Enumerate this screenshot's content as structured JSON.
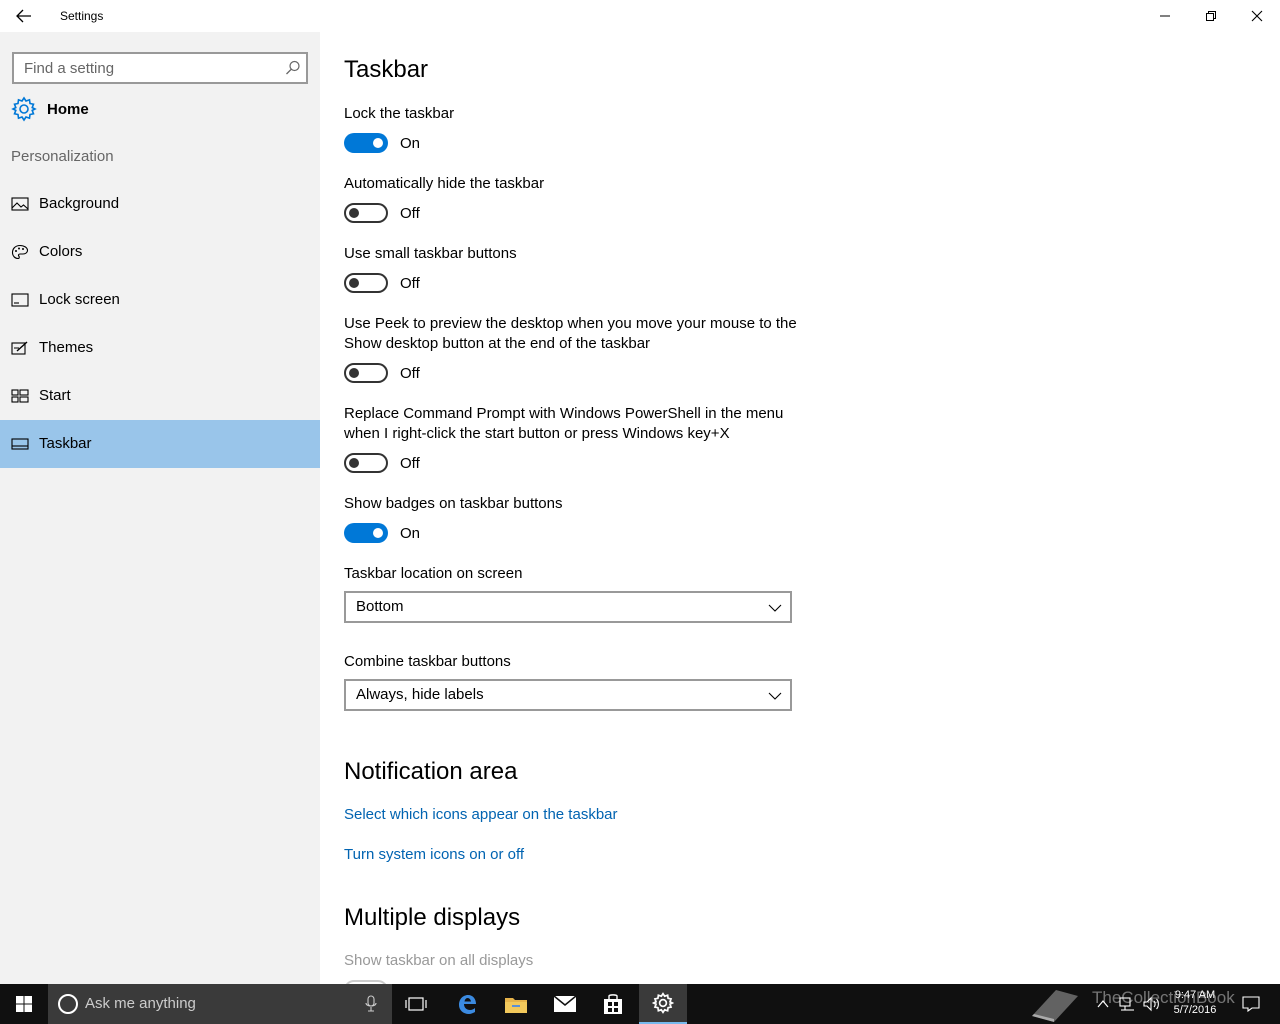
{
  "window": {
    "title": "Settings"
  },
  "sidebar": {
    "search_placeholder": "Find a setting",
    "home_label": "Home",
    "section_label": "Personalization",
    "items": [
      {
        "label": "Background",
        "icon": "picture-icon"
      },
      {
        "label": "Colors",
        "icon": "palette-icon"
      },
      {
        "label": "Lock screen",
        "icon": "lock-screen-icon"
      },
      {
        "label": "Themes",
        "icon": "themes-icon"
      },
      {
        "label": "Start",
        "icon": "start-icon"
      },
      {
        "label": "Taskbar",
        "icon": "taskbar-icon",
        "selected": true
      }
    ]
  },
  "main": {
    "heading": "Taskbar",
    "toggles": [
      {
        "label": "Lock the taskbar",
        "state": "On",
        "on": true
      },
      {
        "label": "Automatically hide the taskbar",
        "state": "Off",
        "on": false
      },
      {
        "label": "Use small taskbar buttons",
        "state": "Off",
        "on": false
      },
      {
        "label": "Use Peek to preview the desktop when you move your mouse to the Show desktop button at the end of the taskbar",
        "state": "Off",
        "on": false
      },
      {
        "label": "Replace Command Prompt with Windows PowerShell in the menu when I right-click the start button or press Windows key+X",
        "state": "Off",
        "on": false
      },
      {
        "label": "Show badges on taskbar buttons",
        "state": "On",
        "on": true
      }
    ],
    "location_label": "Taskbar location on screen",
    "location_value": "Bottom",
    "combine_label": "Combine taskbar buttons",
    "combine_value": "Always, hide labels",
    "notification_heading": "Notification area",
    "notification_links": [
      "Select which icons appear on the taskbar",
      "Turn system icons on or off"
    ],
    "multiple_heading": "Multiple displays",
    "multiple_label": "Show taskbar on all displays"
  },
  "taskbar": {
    "search_text": "Ask me anything",
    "time": "9:47 AM",
    "date": "5/7/2016",
    "watermark": "TheCollectionBook"
  },
  "colors": {
    "accent": "#0078d7",
    "selected_nav": "#99c5ea",
    "link": "#0063b1",
    "sidebar_bg": "#f2f2f2",
    "taskbar_bg": "#101010"
  }
}
